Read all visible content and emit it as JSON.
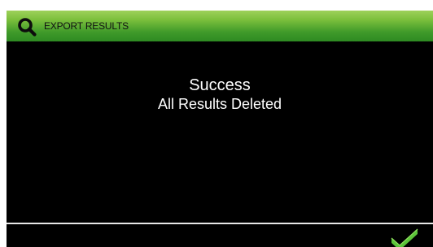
{
  "header": {
    "title": "EXPORT RESULTS",
    "icon": "search-icon"
  },
  "message": {
    "title": "Success",
    "body": "All Results Deleted"
  },
  "footer": {
    "confirm_icon": "check-icon"
  },
  "colors": {
    "header_green": "#4caf32",
    "background": "#000000",
    "text": "#ffffff",
    "check_green": "#5cc43a"
  }
}
